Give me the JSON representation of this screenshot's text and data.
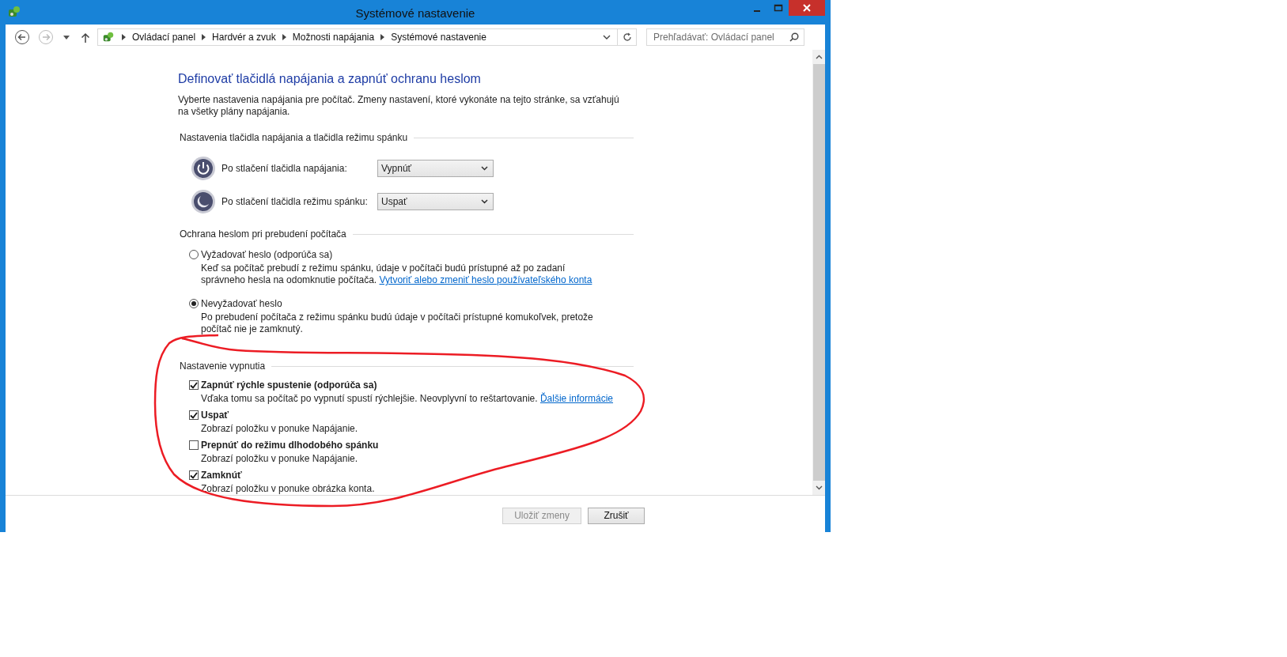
{
  "window": {
    "title": "Systémové nastavenie"
  },
  "address": {
    "path": [
      "Ovládací panel",
      "Hardvér a zvuk",
      "Možnosti napájania",
      "Systémové nastavenie"
    ],
    "search_placeholder": "Prehľadávať: Ovládací panel"
  },
  "page": {
    "heading": "Definovať tlačidlá napájania a zapnúť ochranu heslom",
    "description": "Vyberte nastavenia napájania pre počítač. Zmeny nastavení, ktoré vykonáte na tejto stránke, sa vzťahujú na všetky plány napájania."
  },
  "button_section": {
    "title": "Nastavenia tlačidla napájania a tlačidla režimu spánku",
    "rows": [
      {
        "kind": "power",
        "label": "Po stlačení tlačidla napájania:",
        "value": "Vypnúť"
      },
      {
        "kind": "sleep",
        "label": "Po stlačení tlačidla režimu spánku:",
        "value": "Uspať"
      }
    ]
  },
  "password_section": {
    "title": "Ochrana heslom pri prebudení počítača",
    "options": [
      {
        "label": "Vyžadovať heslo (odporúča sa)",
        "description": "Keď sa počítač prebudí z režimu spánku, údaje v počítači budú prístupné až po zadaní správneho hesla na odomknutie počítača.",
        "link": "Vytvoriť alebo zmeniť heslo používateľského konta",
        "selected": false
      },
      {
        "label": "Nevyžadovať heslo",
        "description": "Po prebudení počítača z režimu spánku budú údaje v počítači prístupné komukoľvek, pretože počítač nie je zamknutý.",
        "selected": true
      }
    ]
  },
  "shutdown_section": {
    "title": "Nastavenie vypnutia",
    "options": [
      {
        "label": "Zapnúť rýchle spustenie (odporúča sa)",
        "description": "Vďaka tomu sa počítač po vypnutí spustí rýchlejšie. Neovplyvní to reštartovanie.",
        "link": "Ďalšie informácie",
        "checked": true
      },
      {
        "label": "Uspať",
        "description": "Zobrazí položku v ponuke Napájanie.",
        "checked": true
      },
      {
        "label": "Prepnúť do režimu dlhodobého spánku",
        "description": "Zobrazí položku v ponuke Napájanie.",
        "checked": false
      },
      {
        "label": "Zamknúť",
        "description": "Zobrazí položku v ponuke obrázka konta.",
        "checked": true
      }
    ]
  },
  "buttons": [
    {
      "label": "Uložiť zmeny",
      "disabled": true
    },
    {
      "label": "Zrušiť",
      "disabled": false
    }
  ]
}
